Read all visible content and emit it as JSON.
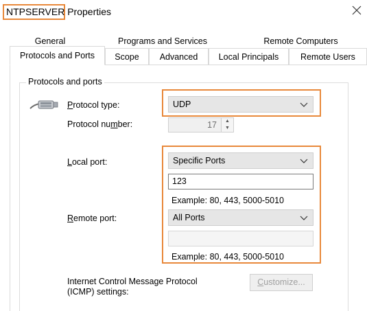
{
  "window": {
    "title_highlighted": "NTPSERVER",
    "title_rest": " Properties"
  },
  "tabs_row1": [
    "General",
    "Programs and Services",
    "Remote Computers"
  ],
  "tabs_row2": [
    "Protocols and Ports",
    "Scope",
    "Advanced",
    "Local Principals",
    "Remote Users"
  ],
  "group": {
    "label": "Protocols and ports"
  },
  "protocol_type": {
    "label_pre": "",
    "label_u": "P",
    "label_post": "rotocol type:",
    "value": "UDP"
  },
  "protocol_number": {
    "label_pre": "Protocol nu",
    "label_u": "m",
    "label_post": "ber:",
    "value": "17"
  },
  "local_port": {
    "label_pre": "",
    "label_u": "L",
    "label_post": "ocal port:",
    "value": "Specific Ports",
    "input_value": "123",
    "example": "Example: 80, 443, 5000-5010"
  },
  "remote_port": {
    "label_pre": "",
    "label_u": "R",
    "label_post": "emote port:",
    "value": "All Ports",
    "input_value": "",
    "example": "Example: 80, 443, 5000-5010"
  },
  "icmp": {
    "line1": "Internet Control Message Protocol",
    "line2": "(ICMP) settings:",
    "button_u": "C",
    "button_rest": "ustomize..."
  },
  "colors": {
    "highlight": "#e8883a"
  }
}
